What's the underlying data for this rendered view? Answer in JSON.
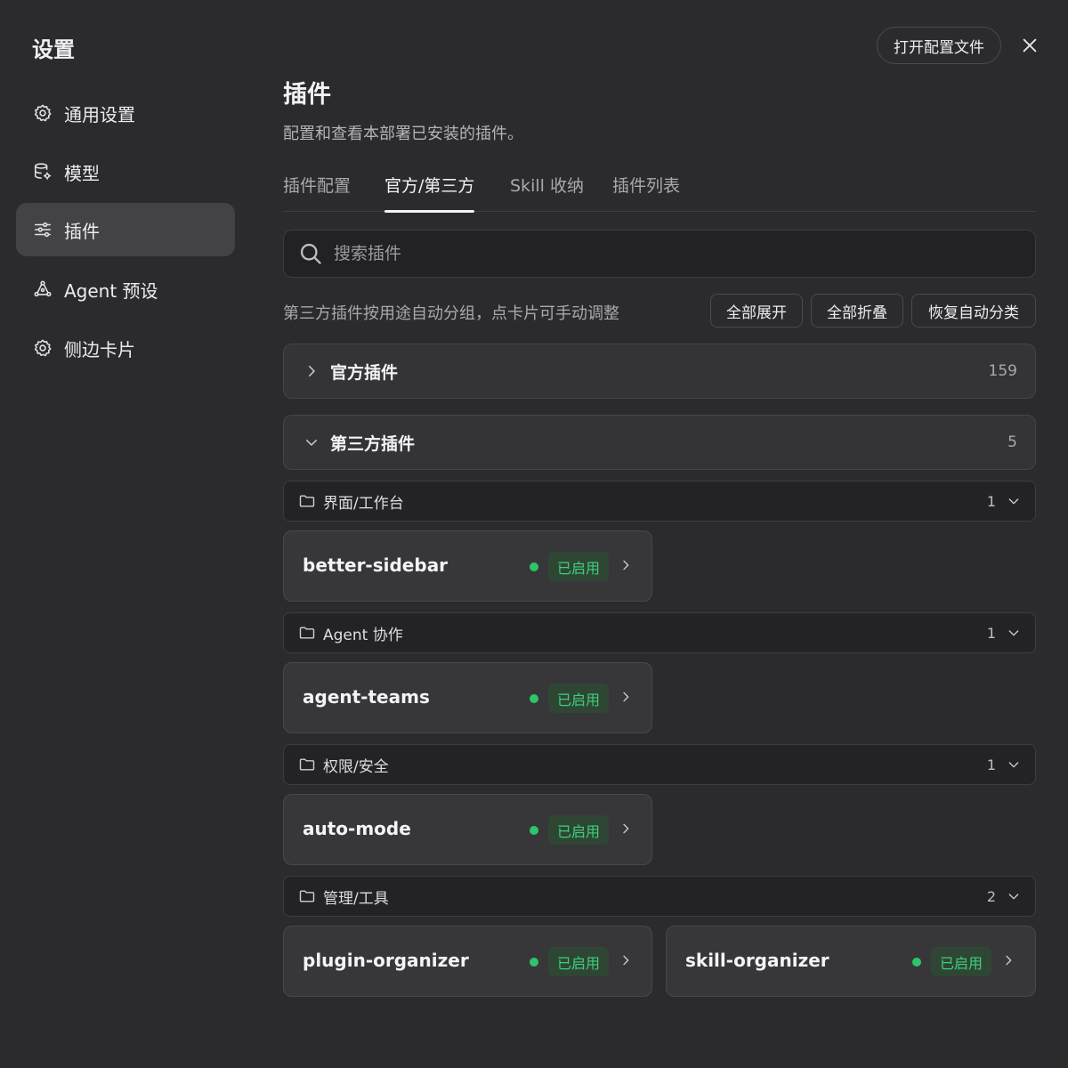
{
  "sidebar": {
    "title": "设置",
    "items": [
      {
        "label": "通用设置",
        "icon": "gear-icon"
      },
      {
        "label": "模型",
        "icon": "database-gear-icon"
      },
      {
        "label": "插件",
        "icon": "sliders-icon",
        "active": true
      },
      {
        "label": "Agent 预设",
        "icon": "agent-icon"
      },
      {
        "label": "侧边卡片",
        "icon": "gear-icon"
      }
    ]
  },
  "header": {
    "open_config_label": "打开配置文件"
  },
  "main": {
    "title": "插件",
    "description": "配置和查看本部署已安装的插件。",
    "tabs": [
      {
        "label": "插件配置"
      },
      {
        "label": "官方/第三方",
        "active": true
      },
      {
        "label": "Skill 收纳"
      },
      {
        "label": "插件列表"
      }
    ],
    "search": {
      "placeholder": "搜索插件",
      "value": ""
    },
    "hint": "第三方插件按用途自动分组，点卡片可手动调整",
    "actions": {
      "expand_all": "全部展开",
      "collapse_all": "全部折叠",
      "reset_auto": "恢复自动分类"
    },
    "groups": [
      {
        "title": "官方插件",
        "count": "159",
        "expanded": false
      },
      {
        "title": "第三方插件",
        "count": "5",
        "expanded": true
      }
    ],
    "categories": [
      {
        "title": "界面/工作台",
        "count": "1",
        "plugins": [
          {
            "name": "better-sidebar",
            "status": "已启用"
          }
        ]
      },
      {
        "title": "Agent 协作",
        "count": "1",
        "plugins": [
          {
            "name": "agent-teams",
            "status": "已启用"
          }
        ]
      },
      {
        "title": "权限/安全",
        "count": "1",
        "plugins": [
          {
            "name": "auto-mode",
            "status": "已启用"
          }
        ]
      },
      {
        "title": "管理/工具",
        "count": "2",
        "plugins": [
          {
            "name": "plugin-organizer",
            "status": "已启用"
          },
          {
            "name": "skill-organizer",
            "status": "已启用"
          }
        ]
      }
    ]
  },
  "colors": {
    "background": "#2b2b2d",
    "enabled_green": "#2ec468",
    "active_nav": "#434347"
  }
}
